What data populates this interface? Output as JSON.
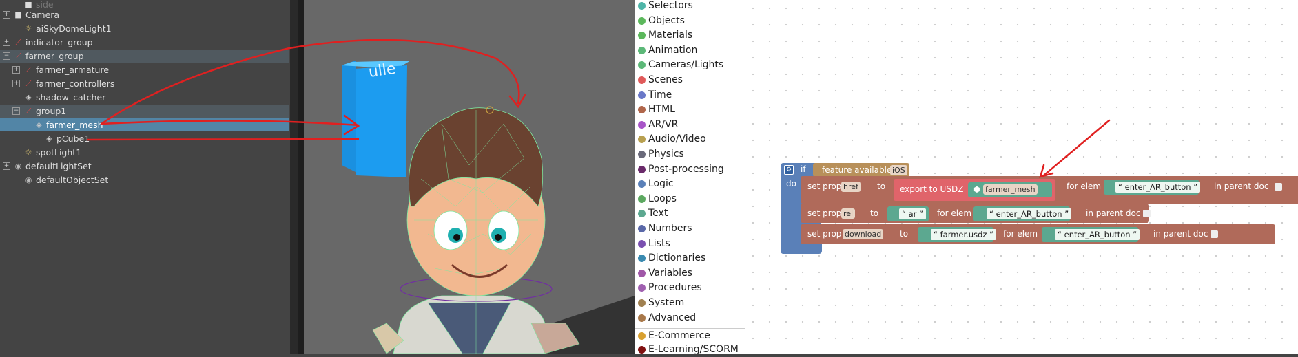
{
  "outliner": {
    "items": [
      {
        "label": "side",
        "icon": "camera-icon",
        "expander": ""
      },
      {
        "label": "Camera",
        "icon": "camera-icon",
        "expander": "+"
      },
      {
        "label": "aiSkyDomeLight1",
        "icon": "light-icon",
        "expander": ""
      },
      {
        "label": "indicator_group",
        "icon": "joint-icon",
        "expander": "+"
      },
      {
        "label": "farmer_group",
        "icon": "joint-icon",
        "expander": "−"
      },
      {
        "label": "farmer_armature",
        "icon": "joint-icon",
        "expander": "+"
      },
      {
        "label": "farmer_controllers",
        "icon": "joint-icon",
        "expander": "+"
      },
      {
        "label": "shadow_catcher",
        "icon": "mesh-icon",
        "expander": ""
      },
      {
        "label": "group1",
        "icon": "joint-icon",
        "expander": "−"
      },
      {
        "label": "farmer_mesh",
        "icon": "mesh-icon",
        "expander": ""
      },
      {
        "label": "pCube1",
        "icon": "mesh-icon",
        "expander": ""
      },
      {
        "label": "spotLight1",
        "icon": "light-icon",
        "expander": ""
      },
      {
        "label": "defaultLightSet",
        "icon": "set-icon",
        "expander": "+"
      },
      {
        "label": "defaultObjectSet",
        "icon": "set-icon",
        "expander": ""
      }
    ]
  },
  "toolbox": {
    "categories": [
      {
        "label": "Selectors",
        "color": "#4fb5a8"
      },
      {
        "label": "Objects",
        "color": "#5cb85c"
      },
      {
        "label": "Materials",
        "color": "#5cb85c"
      },
      {
        "label": "Animation",
        "color": "#5cb878"
      },
      {
        "label": "Cameras/Lights",
        "color": "#5cb878"
      },
      {
        "label": "Scenes",
        "color": "#e05a5a"
      },
      {
        "label": "Time",
        "color": "#6a78c8"
      },
      {
        "label": "HTML",
        "color": "#b0664a"
      },
      {
        "label": "AR/VR",
        "color": "#a855c8"
      },
      {
        "label": "Audio/Video",
        "color": "#b8a050"
      },
      {
        "label": "Physics",
        "color": "#6a6a7a"
      },
      {
        "label": "Post-processing",
        "color": "#6a2a6a"
      },
      {
        "label": "Logic",
        "color": "#5a80b8"
      },
      {
        "label": "Loops",
        "color": "#5ca860"
      },
      {
        "label": "Text",
        "color": "#5ca890"
      },
      {
        "label": "Numbers",
        "color": "#5a68a8"
      },
      {
        "label": "Lists",
        "color": "#7a50b0"
      },
      {
        "label": "Dictionaries",
        "color": "#3a8ab0"
      },
      {
        "label": "Variables",
        "color": "#a058a8"
      },
      {
        "label": "Procedures",
        "color": "#a060b0"
      },
      {
        "label": "System",
        "color": "#a08050"
      },
      {
        "label": "Advanced",
        "color": "#a8784a"
      },
      {
        "label": "E-Commerce",
        "color": "#d8a030"
      },
      {
        "label": "E-Learning/SCORM",
        "color": "#801010"
      }
    ]
  },
  "workspace": {
    "if_label": "if",
    "do_label": "do",
    "feature_label": "feature available",
    "feature_value": "iOS",
    "rows": [
      {
        "set_prop": "set prop",
        "prop": "href",
        "to": "to",
        "export_label": "export to USDZ",
        "object": "farmer_mesh",
        "for_elem": "for elem",
        "elem": "enter_AR_button",
        "in_parent": "in parent doc"
      },
      {
        "set_prop": "set prop",
        "prop": "rel",
        "to": "to",
        "value": "ar",
        "for_elem": "for elem",
        "elem": "enter_AR_button",
        "in_parent": "in parent doc"
      },
      {
        "set_prop": "set prop",
        "prop": "download",
        "to": "to",
        "value": "farmer.usdz",
        "for_elem": "for elem",
        "elem": "enter_AR_button",
        "in_parent": "in parent doc"
      }
    ]
  },
  "colors": {
    "html_block": "#b06a5a",
    "logic_block": "#5a80b8",
    "ar_block": "#e0646a",
    "text_block": "#5ca890",
    "string_quote": "“ ”",
    "annotation": "#e02020"
  },
  "viewport": {
    "cube_text": "ulle"
  }
}
